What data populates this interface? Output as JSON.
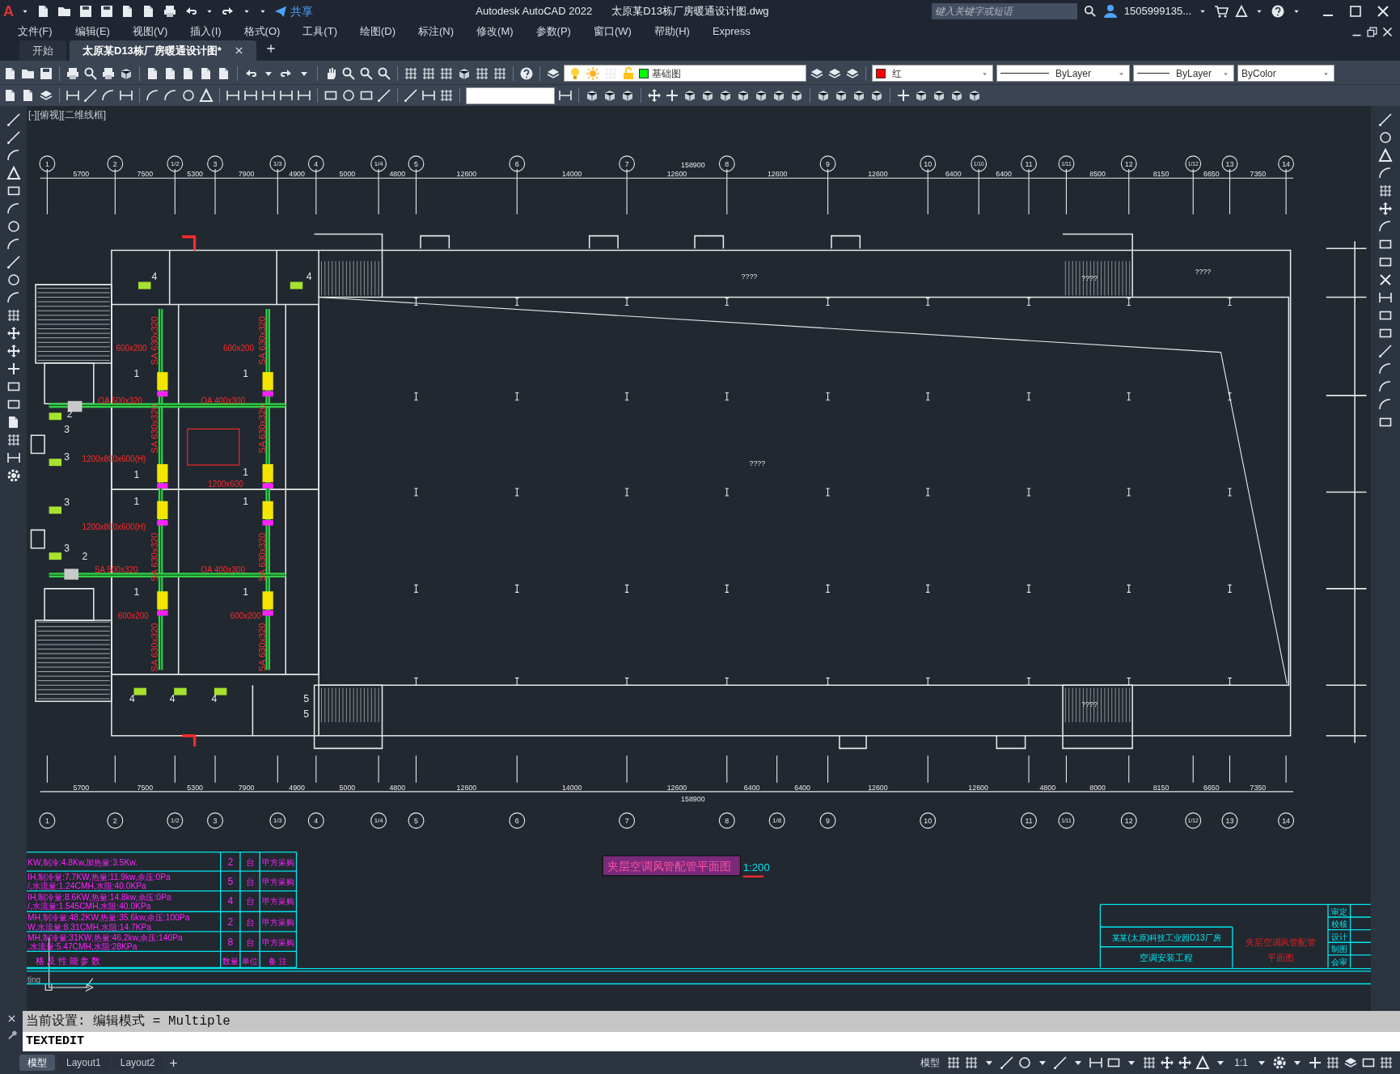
{
  "app": {
    "logo": "A",
    "title": "Autodesk AutoCAD 2022",
    "file": "太原某D13栋厂房暖通设计图.dwg",
    "share": "共享",
    "search": {
      "placeholder": "键入关键字或短语"
    },
    "user": "1505999135..."
  },
  "menu": [
    "文件(F)",
    "编辑(E)",
    "视图(V)",
    "插入(I)",
    "格式(O)",
    "工具(T)",
    "绘图(D)",
    "标注(N)",
    "修改(M)",
    "参数(P)",
    "窗口(W)",
    "帮助(H)",
    "Express"
  ],
  "tabs": [
    {
      "label": "开始",
      "selected": false
    },
    {
      "label": "太原某D13栋厂房暖通设计图*",
      "selected": true
    }
  ],
  "properties": {
    "layer": {
      "value": "基础图",
      "color": "#00ff00"
    },
    "color": {
      "value": "红",
      "color": "#ff0000"
    },
    "linetype": "ByLayer",
    "lineweight": "ByLayer",
    "plotstyle": "ByColor"
  },
  "viewport_label": "[-][俯视][二维线框]",
  "drawing": {
    "top_axes": [
      {
        "label": "1",
        "dim": "5700"
      },
      {
        "label": "2",
        "dim": "7500"
      },
      {
        "label": "1/2",
        "dim": "5300"
      },
      {
        "label": "3",
        "dim": "7900"
      },
      {
        "label": "1/3",
        "dim": "4900"
      },
      {
        "label": "4",
        "dim": "5000"
      },
      {
        "label": "1/4",
        "dim": "4800"
      },
      {
        "label": "5",
        "dim": "12600"
      },
      {
        "label": "6",
        "dim": "14000"
      },
      {
        "label": "7",
        "dim": "12600"
      },
      {
        "label": "8",
        "dim": "12600"
      },
      {
        "label": "9",
        "dim": "12600"
      },
      {
        "label": "10",
        "dim": "6400"
      },
      {
        "label": "1/10",
        "dim": "6400"
      },
      {
        "label": "11"
      },
      {
        "label": "1/11",
        "dim": "8500"
      },
      {
        "label": "12",
        "dim": "8150"
      },
      {
        "label": "1/12",
        "dim": "6650"
      },
      {
        "label": "13",
        "dim": "7350"
      },
      {
        "label": "14"
      }
    ],
    "top_total": "158900",
    "bottom_axes": [
      {
        "label": "1",
        "dim": "5700"
      },
      {
        "label": "2",
        "dim": "7500"
      },
      {
        "label": "1/2",
        "dim": "5300"
      },
      {
        "label": "3",
        "dim": "7900"
      },
      {
        "label": "1/3",
        "dim": "4900"
      },
      {
        "label": "4",
        "dim": "5000"
      },
      {
        "label": "1/4",
        "dim": "4800"
      },
      {
        "label": "5",
        "dim": "12600"
      },
      {
        "label": "6",
        "dim": "14000"
      },
      {
        "label": "7",
        "dim": "12600"
      },
      {
        "label": "8",
        "dim": "6400"
      },
      {
        "label": "1/8",
        "dim": "6400"
      },
      {
        "label": "9",
        "dim": "12600"
      },
      {
        "label": "10",
        "dim": "12600"
      },
      {
        "label": "11",
        "dim": "4800"
      },
      {
        "label": "1/11",
        "dim": "8000"
      },
      {
        "label": "12",
        "dim": "8150"
      },
      {
        "label": "1/12",
        "dim": "6650"
      },
      {
        "label": "13",
        "dim": "7350"
      },
      {
        "label": "14"
      }
    ],
    "bottom_total": "158900",
    "labels": [
      {
        "text": "????",
        "kind": "room"
      },
      {
        "text": "????",
        "kind": "room"
      },
      {
        "text": "????",
        "kind": "room"
      },
      {
        "text": "????",
        "kind": "room"
      },
      {
        "text": "????",
        "kind": "room"
      },
      {
        "text": "OA 500x320",
        "kind": "duct"
      },
      {
        "text": "OA 400x300",
        "kind": "duct"
      },
      {
        "text": "SA 500x320",
        "kind": "duct"
      },
      {
        "text": "OA 400x300",
        "kind": "duct"
      },
      {
        "text": "SA 630x320",
        "kind": "vertical"
      },
      {
        "text": "SA 630x320",
        "kind": "vertical"
      },
      {
        "text": "SA 630x320",
        "kind": "vertical"
      },
      {
        "text": "SA 630x320",
        "kind": "vertical"
      },
      {
        "text": "SA 630x320",
        "kind": "vertical"
      },
      {
        "text": "SA 630x320",
        "kind": "vertical"
      },
      {
        "text": "SA 630x320",
        "kind": "vertical"
      },
      {
        "text": "SA 630x320",
        "kind": "vertical"
      },
      {
        "text": "1200x800x600(H)",
        "kind": "duct"
      },
      {
        "text": "1200x800x600(H)",
        "kind": "duct"
      },
      {
        "text": "1200x600",
        "kind": "duct"
      },
      {
        "text": "600x200",
        "kind": "duct"
      },
      {
        "text": "600x200",
        "kind": "duct"
      },
      {
        "text": "600x200",
        "kind": "duct"
      },
      {
        "text": "600x200",
        "kind": "duct"
      },
      {
        "text": "1",
        "kind": "tag"
      },
      {
        "text": "1",
        "kind": "tag"
      },
      {
        "text": "1",
        "kind": "tag"
      },
      {
        "text": "1",
        "kind": "tag"
      },
      {
        "text": "1",
        "kind": "tag"
      },
      {
        "text": "1",
        "kind": "tag"
      },
      {
        "text": "1",
        "kind": "tag"
      },
      {
        "text": "1",
        "kind": "tag"
      },
      {
        "text": "2",
        "kind": "tag"
      },
      {
        "text": "2",
        "kind": "tag"
      },
      {
        "text": "3",
        "kind": "tag"
      },
      {
        "text": "3",
        "kind": "tag"
      },
      {
        "text": "3",
        "kind": "tag"
      },
      {
        "text": "3",
        "kind": "tag"
      },
      {
        "text": "4",
        "kind": "tag"
      },
      {
        "text": "4",
        "kind": "tag"
      },
      {
        "text": "4",
        "kind": "tag"
      },
      {
        "text": "4",
        "kind": "tag"
      },
      {
        "text": "4",
        "kind": "tag"
      },
      {
        "text": "5",
        "kind": "tag"
      },
      {
        "text": "5",
        "kind": "tag"
      }
    ],
    "ucs_text": "ting",
    "title": "夹层空调风管配管平面图",
    "scale": "1:200",
    "equipment_table": {
      "rows": [
        {
          "spec": [
            "KW,制冷:4.8Kw,加热量:3.5Kw."
          ],
          "qty": "2",
          "unit": "台",
          "note": "甲方采购"
        },
        {
          "spec": [
            "IH,制冷量:7.7KW,热量:11.9kw,余压:0Pa",
            "/,水流量:1.24CMH,水阻:40.0KPa"
          ],
          "qty": "5",
          "unit": "台",
          "note": "甲方采购"
        },
        {
          "spec": [
            "IH,制冷量:8.6KW,热量:14.8kw,余压:0Pa",
            "/,水流量:1.545CMH,水阻:40.0KPa"
          ],
          "qty": "4",
          "unit": "台",
          "note": "甲方采购"
        },
        {
          "spec": [
            "MH,制冷量:48.2KW,热量:35.6kw,余压:100Pa",
            "W,水流量:8.31CMH,水阻:14.7KPa"
          ],
          "qty": "2",
          "unit": "台",
          "note": "甲方采购"
        },
        {
          "spec": [
            "MH,制冷量:31KW,热量:46.2kw,余压:140Pa",
            ",水流量:5.47CMH,水阻:28KPa"
          ],
          "qty": "8",
          "unit": "台",
          "note": "甲方采购"
        }
      ],
      "header": {
        "spec": "格 及 性 能 参 数",
        "qty": "数量",
        "unit": "单位",
        "note": "备 注"
      }
    },
    "title_block": {
      "project": "某某(太原)科技工业园D13厂房",
      "subproject": "空调安装工程",
      "drawing_name": [
        "夹层空调风管配管",
        "平面图"
      ],
      "roles": [
        "审定",
        "校核",
        "设计",
        "制图",
        "会审"
      ]
    }
  },
  "command": {
    "history": "当前设置: 编辑模式 = Multiple",
    "input": "TEXTEDIT"
  },
  "layouts": [
    {
      "label": "模型",
      "selected": true
    },
    {
      "label": "Layout1",
      "selected": false
    },
    {
      "label": "Layout2",
      "selected": false
    }
  ],
  "status": {
    "space": "模型",
    "scale": "1:1"
  }
}
